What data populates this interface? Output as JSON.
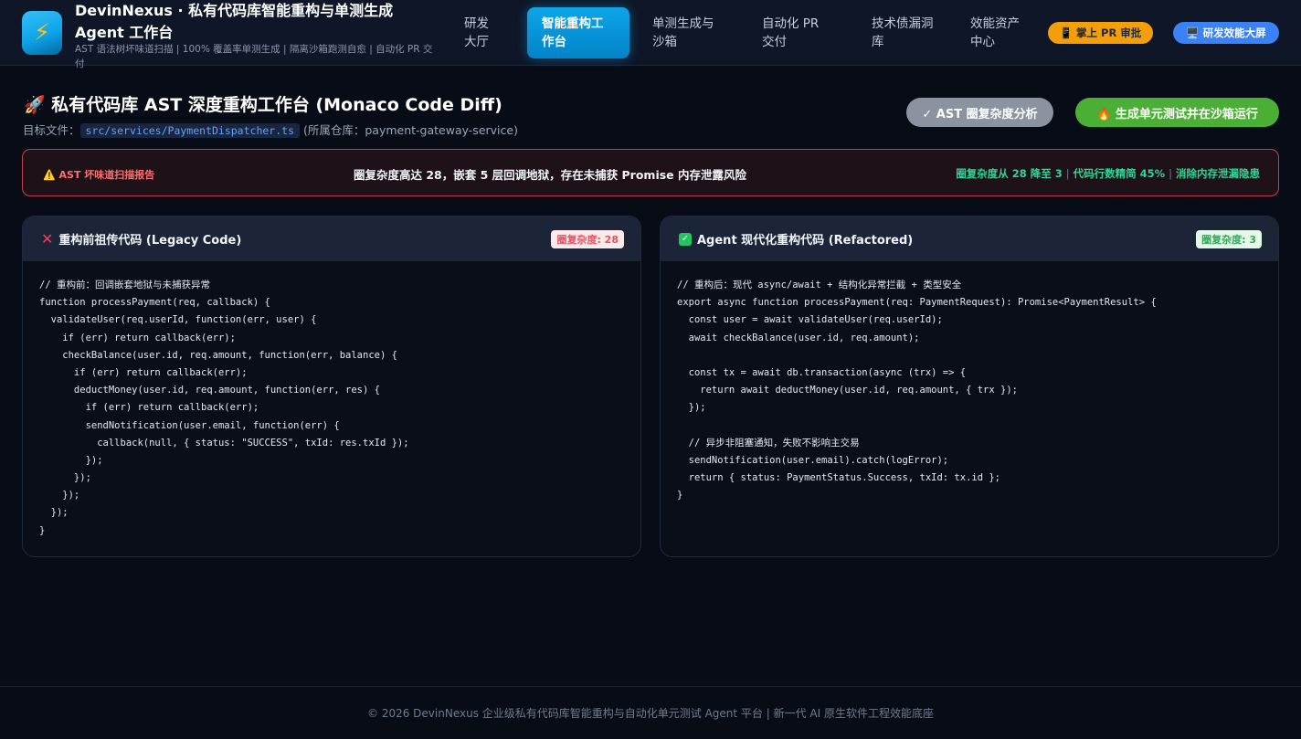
{
  "app": {
    "logo_icon": "lightning-bolt-icon",
    "title": "DevinNexus · 私有代码库智能重构与单测生成 Agent 工作台",
    "subtitle": "AST 语法树坏味道扫描 | 100% 覆盖率单测生成 | 隔离沙箱跑测自愈 | 自动化 PR 交付"
  },
  "nav": {
    "tabs": [
      {
        "label": "研发大厅",
        "active": false
      },
      {
        "label": "智能重构工作台",
        "active": true
      },
      {
        "label": "单测生成与沙箱",
        "active": false
      },
      {
        "label": "自动化 PR 交付",
        "active": false
      },
      {
        "label": "技术债漏洞库",
        "active": false
      },
      {
        "label": "效能资产中心",
        "active": false
      }
    ],
    "pr_review": {
      "icon": "phone-icon",
      "label": "📱 掌上 PR 审批"
    },
    "dashboard": {
      "icon": "monitor-icon",
      "label": "🖥️ 研发效能大屏"
    }
  },
  "page": {
    "title": "🚀 私有代码库 AST 深度重构工作台 (Monaco Code Diff)",
    "target_prefix": "目标文件：",
    "target_file": "src/services/PaymentDispatcher.ts",
    "repo_text": "(所属仓库：payment-gateway-service)",
    "btn_ast": "✓ AST 圈复杂度分析",
    "btn_generate": "🔥 生成单元测试并在沙箱运行"
  },
  "alert": {
    "tag": "⚠️ AST 坏味道扫描报告",
    "message": "圈复杂度高达 28，嵌套 5 层回调地狱，存在未捕获 Promise 内存泄露风险",
    "metrics": [
      "圈复杂度从 28 降至 3",
      "代码行数精简 45%",
      "消除内存泄漏隐患"
    ]
  },
  "legacy": {
    "title": "重构前祖传代码 (Legacy Code)",
    "badge": "圈复杂度: 28",
    "code": [
      "// 重构前：回调嵌套地狱与未捕获异常",
      "function processPayment(req, callback) {",
      "  validateUser(req.userId, function(err, user) {",
      "    if (err) return callback(err);",
      "    checkBalance(user.id, req.amount, function(err, balance) {",
      "      if (err) return callback(err);",
      "      deductMoney(user.id, req.amount, function(err, res) {",
      "        if (err) return callback(err);",
      "        sendNotification(user.email, function(err) {",
      "          callback(null, { status: \"SUCCESS\", txId: res.txId });",
      "        });",
      "      });",
      "    });",
      "  });",
      "}"
    ]
  },
  "refactored": {
    "title": "Agent 现代化重构代码 (Refactored)",
    "badge": "圈复杂度: 3",
    "code": [
      "// 重构后：现代 async/await + 结构化异常拦截 + 类型安全",
      "export async function processPayment(req: PaymentRequest): Promise<PaymentResult> {",
      "  const user = await validateUser(req.userId);",
      "  await checkBalance(user.id, req.amount);",
      "",
      "  const tx = await db.transaction(async (trx) => {",
      "    return await deductMoney(user.id, req.amount, { trx });",
      "  });",
      "",
      "  // 异步非阻塞通知，失败不影响主交易",
      "  sendNotification(user.email).catch(logError);",
      "  return { status: PaymentStatus.Success, txId: tx.id };",
      "}"
    ]
  },
  "footer": {
    "text": "© 2026 DevinNexus 企业级私有代码库智能重构与自动化单元测试 Agent 平台 | 新一代 AI 原生软件工程效能底座"
  }
}
